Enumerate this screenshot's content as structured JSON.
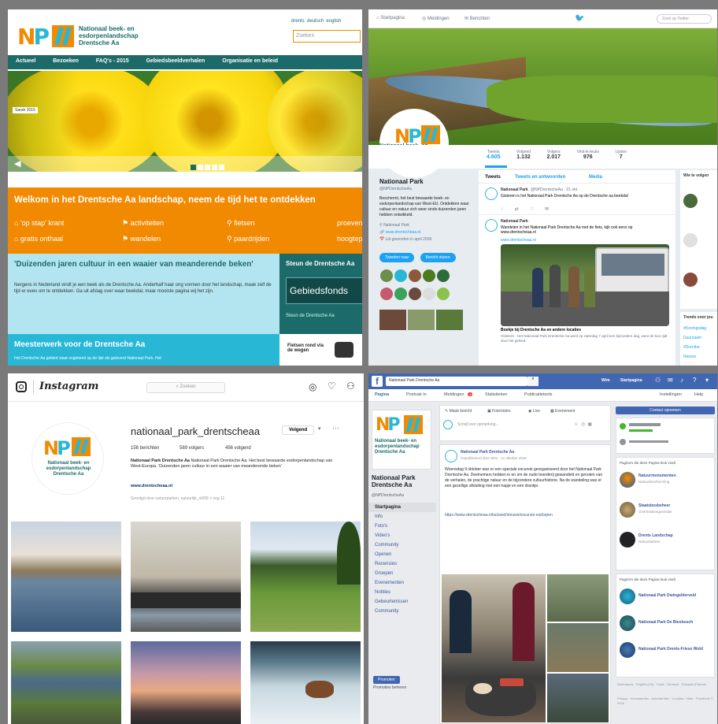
{
  "website": {
    "logo_text": "Nationaal beek- en esdorpenlandschap Drentsche Aa",
    "lang_links": [
      "drents",
      "deutsch",
      "english"
    ],
    "search_placeholder": "Zoeken",
    "nav": [
      "Actueel",
      "Bezoeken",
      "FAQ's - 2015",
      "Gebiedsbeeldverhalen",
      "Organisatie en beleid"
    ],
    "slide_badge": "Sarah 2015",
    "banner_title": "Welkom in het Drentsche Aa landschap, neem de tijd het te ontdekken",
    "banner_links": [
      "'op stap' krant",
      "activiteiten",
      "fietsen",
      "gratis onthaal",
      "wandelen",
      "paardrijden",
      "proeven",
      "hoogtepunten"
    ],
    "article_title": "'Duizenden jaren cultuur in een waaier van meanderende beken'",
    "article_body": "Nergens in Nederland vindt je een beek als de Drentsche Aa. Anderhalf haar ong vormen door het landschap, maak zelf de tijd er even om te ontdekken. Ga uit afslag over waar beekdal, maar mooiste pagina wij het zijn.",
    "side_box_title": "Steun de Drentsche Aa",
    "side_box_button": "Gebiedsfonds",
    "side_box_link": "Steun de Drentsche Aa",
    "feature_title": "Meesterwerk voor de Drentsche Aa",
    "feature_body": "Het Drentsche Aa gebied staat ongekend op de lijst als geleverd Nationaal Park. Het",
    "promo_text": "Fietsen rond via de wegen"
  },
  "twitter": {
    "tabs": [
      "Startpagina",
      "Meldingen",
      "Berichten"
    ],
    "search_placeholder": "Zoek op Twitter",
    "profile_name": "Nationaal Park",
    "profile_handle": "@NPDrentscheAa",
    "stats": [
      {
        "label": "Tweets",
        "value": "4.605"
      },
      {
        "label": "Volgend",
        "value": "1.132"
      },
      {
        "label": "Volgers",
        "value": "2.017"
      },
      {
        "label": "Vind-ik-leuks",
        "value": "976"
      },
      {
        "label": "Lijsten",
        "value": "7"
      }
    ],
    "feed_tabs": [
      "Tweets",
      "Tweets en antwoorden",
      "Media"
    ],
    "bio": "Beschermt, het best bewaarde beek- en esdorpenlandschap van West-EU. Ontdekken waar cultuur en natuur zich weer sinds duizenden jaren hebben ontwikkeld.",
    "bio_meta": [
      "Nationaal Park",
      "www.drentscheaa.nl",
      "Lid geworden in april 2009"
    ],
    "buttons": [
      "Tweeten naar",
      "Bericht sturen"
    ],
    "tweet_author": "Nationaal Park",
    "tweet_handle": "@NPDrentscheAa · 21 okt.",
    "tweet_text": "Gisteren is het Nationaal Park Drentsche Aa op de Drentsche aa beekdal",
    "tweet2_text": "Wandelen in het Nationaal Park Drentsche Aa met de fiets, kijk ook eens op www.drentscheaa.nl",
    "tweet_link": "www.drentscheaa.nl",
    "image_caption_title": "Boekje bij Drentsche Aa en andere locaties",
    "image_caption_body": "Gisteren - Het Nationaal Park Drentsche Aa werd op zaterdag 7 april een bijzondere dag, want de bus rijdt door het gebied.",
    "who_to_follow": "Wie te volgen",
    "trends_title": "Trends voor jou",
    "trends": [
      "#Koningsdag",
      "Duurzaam",
      "#Drenthe",
      "Nieuws"
    ]
  },
  "instagram": {
    "brand": "Instagram",
    "search_placeholder": "Zoeken",
    "username": "nationaal_park_drentscheaa",
    "follow_button": "Volgend",
    "counts": [
      "158 berichten",
      "589 volgers",
      "456 volgend"
    ],
    "bio_name": "Nationaal Park Drentsche Aa",
    "bio_text": "Nationaal Park Drentsche Aa. Het best bewaarde esdorpenlandschap van West-Europa. 'Duizenden jaren cultuur in een waaier van meanderende beken'",
    "bio_link": "www.drentscheaa.nl",
    "followed_by": "Gevolgd door natuurparken, natuurlijk_nl999 + nog 11"
  },
  "facebook": {
    "search_placeholder": "Nationaal Park Drentsche Aa",
    "profile_chip": "Wim",
    "top_right": "Startpagina",
    "tabs": [
      "Pagina",
      "Postvak In",
      "Meldingen",
      "Statistieken",
      "Publicatietools"
    ],
    "tab_badge": "1",
    "right_links": [
      "Instellingen",
      "Help"
    ],
    "page_name": "Nationaal Park Drentsche Aa",
    "page_handle": "@NPDrentscheAa",
    "side_menu": [
      "Startpagina",
      "Info",
      "Foto's",
      "Video's",
      "Community",
      "Openen",
      "Recensies",
      "Groepen",
      "Evenementen",
      "Notities",
      "Gebeurtenissen",
      "Community"
    ],
    "side_button": "Promoten",
    "side_manage": "Promoties beheren",
    "composer_actions": [
      "Maak bericht",
      "Foto/video",
      "Live",
      "Evenement"
    ],
    "composer_placeholder": "Schrijf een opmerking...",
    "post_author": "Nationaal Park Drentsche Aa",
    "post_meta": "Gepubliceerd door Wim · 21 oktober 2018",
    "post_text": "Woensdag 9 oktober was er een speciale excursie georganiseerd door het Nationaal Park Drentsche Aa. Deelnemers hebben in en om de oude boerderij gewandeld en genoten van de verhalen, de prachtige natuur en de bijzondere cultuurhistorie. Na de wandeling was er een gezellige afsluiting met een hapje en een drankje.",
    "post_link_text": "https://www.drentscheaa.nl/actueel/nieuws/excursie-esdorpen",
    "cta_button": "Contact opnemen",
    "right_heading1": "Pagina's die deze Pagina leuk vindt",
    "right_pages": [
      {
        "name": "Natuurmonumenten",
        "sub": "Natuurbescherming"
      },
      {
        "name": "Staatsbosbeheer",
        "sub": "Overheidsorganisatie"
      },
      {
        "name": "Drents Landschap",
        "sub": "Natuurbeheer"
      }
    ],
    "right_heading2": "Pagina's die deze Pagina leuk vindt",
    "right_pages2": [
      {
        "name": "Nationaal Park Dwingelderveld",
        "sub": ""
      },
      {
        "name": "Nationaal Park De Biesbosch",
        "sub": ""
      },
      {
        "name": "Nationaal Park Drents-Friese Wold",
        "sub": ""
      }
    ],
    "footer": "Nederlands · English (US) · Frysk · Deutsch · Français (France)",
    "footer2": "Privacy · Voorwaarden · Advertenties · Cookies · Meer · Facebook © 2018"
  },
  "colors": {
    "teal_dark": "#1c6a6a",
    "orange": "#f18a00",
    "light_blue": "#b3e5f0",
    "cyan": "#29b7d6",
    "twitter_blue": "#1da1f2",
    "fb_blue": "#4267b2"
  }
}
